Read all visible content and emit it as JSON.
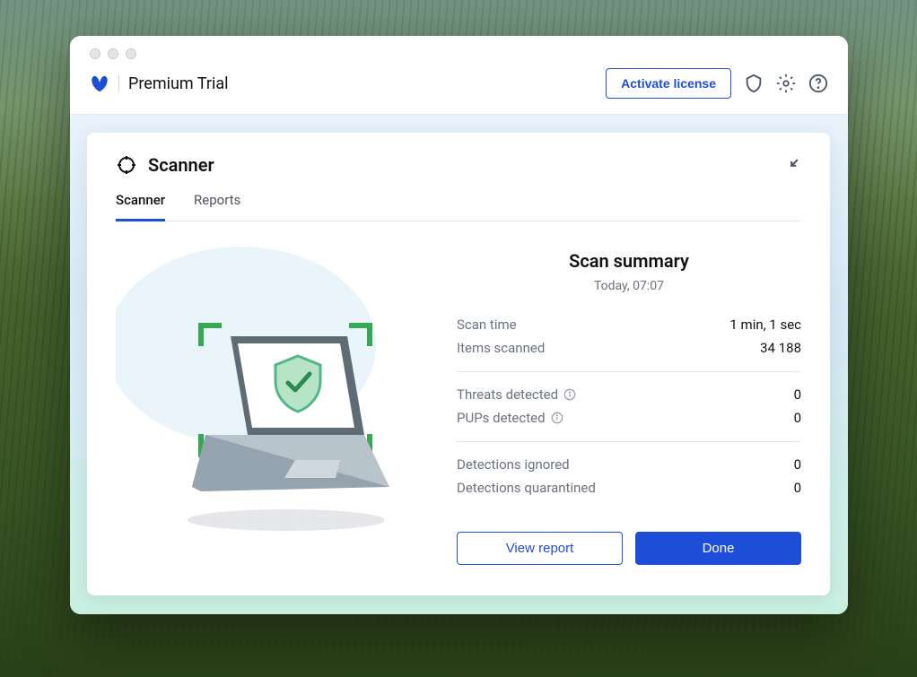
{
  "header": {
    "title": "Premium Trial",
    "activate_label": "Activate license"
  },
  "card": {
    "title": "Scanner",
    "tabs": [
      {
        "label": "Scanner"
      },
      {
        "label": "Reports"
      }
    ]
  },
  "summary": {
    "title": "Scan summary",
    "date": "Today, 07:07",
    "rows1": [
      {
        "label": "Scan time",
        "value": "1 min, 1 sec"
      },
      {
        "label": "Items scanned",
        "value": "34 188"
      }
    ],
    "rows2": [
      {
        "label": "Threats detected",
        "value": "0",
        "info": true
      },
      {
        "label": "PUPs detected",
        "value": "0",
        "info": true
      }
    ],
    "rows3": [
      {
        "label": "Detections ignored",
        "value": "0"
      },
      {
        "label": "Detections quarantined",
        "value": "0"
      }
    ],
    "view_report_label": "View report",
    "done_label": "Done"
  }
}
